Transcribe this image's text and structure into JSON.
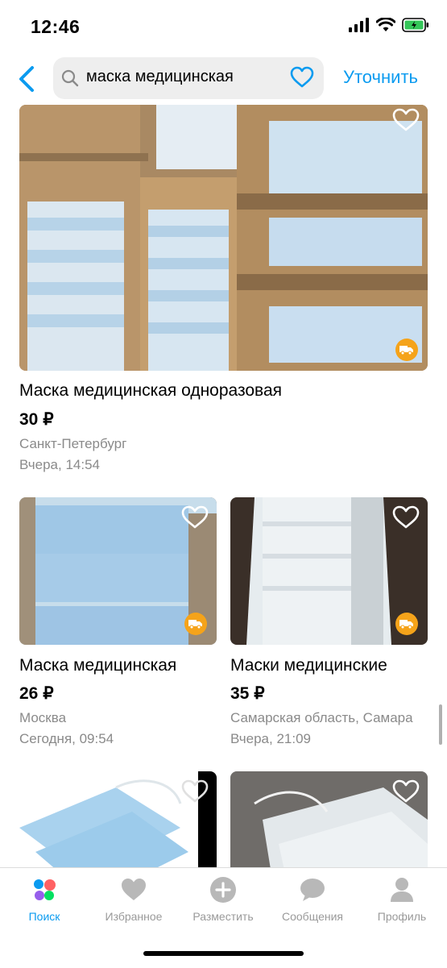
{
  "status": {
    "time": "12:46"
  },
  "nav": {
    "search_query": "маска медицинская",
    "refine_label": "Уточнить"
  },
  "listings": [
    {
      "title": "Маска медицинская одноразовая",
      "price": "30 ₽",
      "location": "Санкт-Петербург",
      "date": "Вчера, 14:54",
      "delivery": true
    },
    {
      "title": "Маска медицинская",
      "price": "26 ₽",
      "location": "Москва",
      "date": "Сегодня, 09:54",
      "delivery": true
    },
    {
      "title": "Маски медицинские",
      "price": "35 ₽",
      "location": "Самарская область, Самара",
      "date": "Вчера, 21:09",
      "delivery": true
    },
    {
      "title": "",
      "price": "",
      "location": "",
      "date": "",
      "delivery": false
    },
    {
      "title": "",
      "price": "",
      "location": "",
      "date": "",
      "delivery": false
    }
  ],
  "tabbar": {
    "items": [
      {
        "label": "Поиск",
        "icon": "search-dots-icon",
        "active": true
      },
      {
        "label": "Избранное",
        "icon": "heart-icon",
        "active": false
      },
      {
        "label": "Разместить",
        "icon": "plus-circle-icon",
        "active": false
      },
      {
        "label": "Сообщения",
        "icon": "chat-bubble-icon",
        "active": false
      },
      {
        "label": "Профиль",
        "icon": "person-icon",
        "active": false
      }
    ]
  },
  "colors": {
    "accent": "#0a9bf0",
    "delivery_badge": "#f5a31a",
    "secondary_text": "#8a8a8a"
  }
}
